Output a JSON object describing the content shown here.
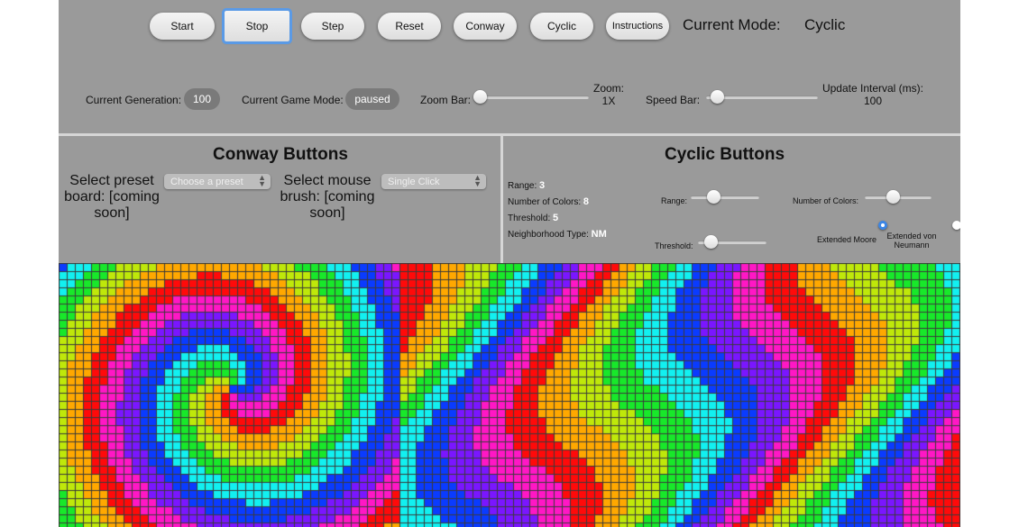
{
  "controls": {
    "buttons": [
      {
        "id": "start",
        "label": "Start"
      },
      {
        "id": "stop",
        "label": "Stop"
      },
      {
        "id": "step",
        "label": "Step"
      },
      {
        "id": "reset",
        "label": "Reset"
      },
      {
        "id": "conway",
        "label": "Conway"
      },
      {
        "id": "cyclic",
        "label": "Cyclic"
      },
      {
        "id": "instructions",
        "label": "Instructions"
      }
    ],
    "current_mode_label": "Current Mode:",
    "current_mode_value": "Cyclic"
  },
  "status": {
    "generation_label": "Current Generation:",
    "generation_value": "100",
    "game_mode_label": "Current Game Mode:",
    "game_mode_value": "paused",
    "zoom_bar_label": "Zoom Bar:",
    "zoom_label": "Zoom:",
    "zoom_value": "1X",
    "zoom_level": 0.0,
    "speed_bar_label": "Speed Bar:",
    "update_interval_label": "Update Interval (ms):",
    "update_interval_value": "100",
    "speed_level": 0.05
  },
  "conway": {
    "title": "Conway Buttons",
    "preset_label": "Select preset board: [coming soon]",
    "preset_placeholder": "Choose a preset",
    "brush_label": "Select mouse brush: [coming soon]",
    "brush_value": "Single Click"
  },
  "cyclic": {
    "title": "Cyclic Buttons",
    "range_label": "Range:",
    "range_value": "3",
    "colors_label": "Number of Colors:",
    "colors_value": "8",
    "threshold_label": "Threshold:",
    "threshold_value": "5",
    "neighborhood_label": "Neighborhood Type:",
    "neighborhood_value": "NM",
    "range_slider_label": "Range:",
    "range_level": 0.3,
    "colors_slider_label": "Number of Colors:",
    "colors_level": 0.4,
    "threshold_slider_label": "Threshold:",
    "threshold_level": 0.12,
    "radio_moore": "Extended Moore",
    "radio_neumann": "Extended von Neumann",
    "selected_neighborhood": "moore"
  },
  "board": {
    "palette": [
      "#0a3bff",
      "#7a16ff",
      "#ff17c5",
      "#ff0a0a",
      "#ffa800",
      "#bfe80a",
      "#18e82a",
      "#12f0f0"
    ],
    "grid_color": "#3a3a3a"
  }
}
